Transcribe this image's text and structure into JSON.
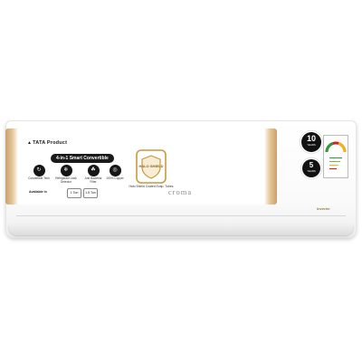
{
  "product": {
    "brand_tag": "TATA Product",
    "pill_title": "4-in-1 Smart Convertible",
    "features": [
      {
        "icon": "convertible-icon",
        "glyph": "↻",
        "caption": "Convertible Tech"
      },
      {
        "icon": "refrigerant-icon",
        "glyph": "❄",
        "caption": "Refrigerant Leak Detector"
      },
      {
        "icon": "filter-icon",
        "glyph": "☘",
        "caption": "Anti Bacterial Filter"
      },
      {
        "icon": "copper-icon",
        "glyph": "◎",
        "caption": "100% Copper"
      }
    ],
    "available_in": "Available in",
    "tonnages": [
      "1 Ton",
      "1.5 Ton"
    ],
    "shield_title": "HALO SHIELD",
    "shield_caption": "Halo Shield Coated Evap. Tubes",
    "logo": "croma",
    "inverter": "Inverter"
  },
  "warranty": {
    "big_num": "10",
    "big_sub": "YEARS",
    "small_num": "5",
    "small_sub": "YEARS"
  },
  "colors": {
    "band_gold": "#c9a06d",
    "badge_black": "#111111",
    "shield_gold": "#c99a3c",
    "label_red": "#d81e1e",
    "label_green": "#2e9a3b"
  }
}
